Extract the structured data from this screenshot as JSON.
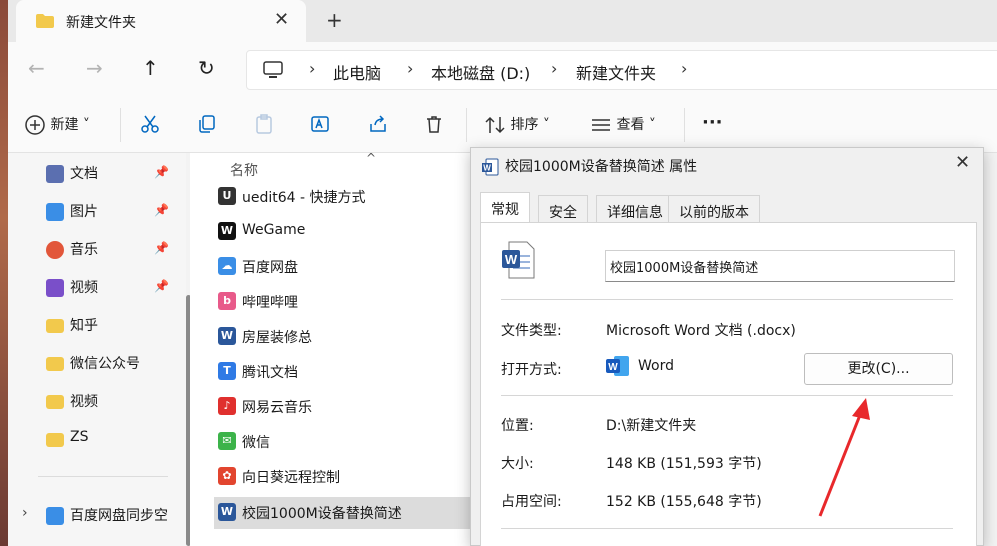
{
  "tab": {
    "title": "新建文件夹",
    "close": "✕",
    "new_tab": "+"
  },
  "nav": {
    "back": "←",
    "forward": "→",
    "up": "↑",
    "refresh": "↻",
    "breadcrumbs": [
      "此电脑",
      "本地磁盘 (D:)",
      "新建文件夹"
    ],
    "separator": "›"
  },
  "toolbar": {
    "new_label": "新建",
    "sort_label": "排序",
    "view_label": "查看",
    "more": "···"
  },
  "sidebar": {
    "items": [
      {
        "label": "文档",
        "icon": "documents-icon",
        "color": "#5b6fb0",
        "pinned": true
      },
      {
        "label": "图片",
        "icon": "pictures-icon",
        "color": "#3a8ee6",
        "pinned": true
      },
      {
        "label": "音乐",
        "icon": "music-icon",
        "color": "#e2563a",
        "pinned": true
      },
      {
        "label": "视频",
        "icon": "videos-icon",
        "color": "#7a4fc9",
        "pinned": true
      },
      {
        "label": "知乎",
        "icon": "folder-icon",
        "color": "#f2c94c",
        "pinned": false
      },
      {
        "label": "微信公众号",
        "icon": "folder-icon",
        "color": "#f2c94c",
        "pinned": false
      },
      {
        "label": "视频",
        "icon": "folder-icon",
        "color": "#f2c94c",
        "pinned": false
      },
      {
        "label": "ZS",
        "icon": "folder-icon",
        "color": "#f2c94c",
        "pinned": false
      }
    ],
    "group": {
      "label": "百度网盘同步空",
      "expander": "›"
    },
    "pin": "📌"
  },
  "filelist": {
    "column_name": "名称",
    "sort_arrow": "^",
    "files": [
      {
        "name": "uedit64 - 快捷方式",
        "icon": "uedit-icon",
        "color": "#333333",
        "glyph": "U"
      },
      {
        "name": "WeGame",
        "icon": "wegame-icon",
        "color": "#111111",
        "glyph": "W"
      },
      {
        "name": "百度网盘",
        "icon": "baidu-netdisk-icon",
        "color": "#3a8ee6",
        "glyph": "☁"
      },
      {
        "name": "哔哩哔哩",
        "icon": "bilibili-icon",
        "color": "#e85a8a",
        "glyph": "b"
      },
      {
        "name": "房屋装修总",
        "icon": "word-doc-icon",
        "color": "#2b579a",
        "glyph": "W"
      },
      {
        "name": "腾讯文档",
        "icon": "tencent-docs-icon",
        "color": "#2f7ae5",
        "glyph": "T"
      },
      {
        "name": "网易云音乐",
        "icon": "netease-music-icon",
        "color": "#e0302e",
        "glyph": "♪"
      },
      {
        "name": "微信",
        "icon": "wechat-icon",
        "color": "#3cb34a",
        "glyph": "✉"
      },
      {
        "name": "向日葵远程控制",
        "icon": "sunlogin-icon",
        "color": "#e2452f",
        "glyph": "✿"
      },
      {
        "name": "校园1000M设备替换简述",
        "icon": "word-doc-icon",
        "color": "#2b579a",
        "glyph": "W",
        "selected": true
      }
    ]
  },
  "dialog": {
    "title": "校园1000M设备替换简述 属性",
    "close": "✕",
    "tabs": [
      "常规",
      "安全",
      "详细信息",
      "以前的版本"
    ],
    "active_tab": "常规",
    "filename": "校园1000M设备替换简述",
    "rows": {
      "file_type_label": "文件类型:",
      "file_type_value": "Microsoft Word 文档 (.docx)",
      "open_with_label": "打开方式:",
      "open_with_value": "Word",
      "change_button": "更改(C)...",
      "location_label": "位置:",
      "location_value": "D:\\新建文件夹",
      "size_label": "大小:",
      "size_value": "148 KB (151,593 字节)",
      "disk_size_label": "占用空间:",
      "disk_size_value": "152 KB (155,648 字节)"
    }
  },
  "colors": {
    "accent": "#0067c0",
    "word_blue": "#2b579a",
    "annotation_red": "#e8282b"
  }
}
